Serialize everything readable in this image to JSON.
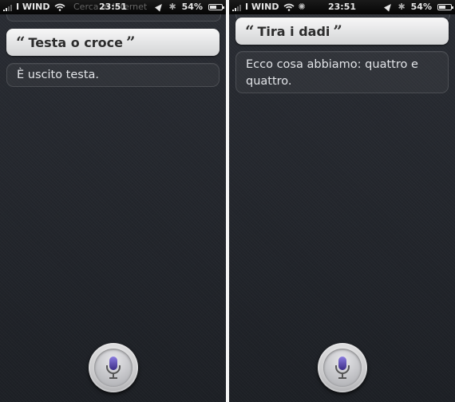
{
  "colors": {
    "mic_purple": "#5e4fa6",
    "bubble_text": "#2c2c2c",
    "answer_text": "#e2e4e8"
  },
  "left_screen": {
    "status": {
      "carrier": "I WIND",
      "ghost_text": "Cerca in Internet",
      "time": "23:51",
      "battery_percent_label": "54%",
      "battery_level": 0.54
    },
    "query": {
      "open_quote": "“",
      "text": "Testa o croce",
      "close_quote": "”"
    },
    "answer": "È uscito testa."
  },
  "right_screen": {
    "status": {
      "carrier": "I WIND",
      "time": "23:51",
      "battery_percent_label": "54%",
      "battery_level": 0.54
    },
    "query": {
      "open_quote": "“",
      "text": "Tira i dadi",
      "close_quote": "”"
    },
    "answer": "Ecco cosa abbiamo: quattro e quattro."
  },
  "icons": {
    "wifi": "wifi-icon",
    "location": "location-arrow-icon",
    "bluetooth": "bluetooth-icon",
    "battery": "battery-icon",
    "activity": "activity-spinner-icon",
    "microphone": "microphone-icon"
  }
}
